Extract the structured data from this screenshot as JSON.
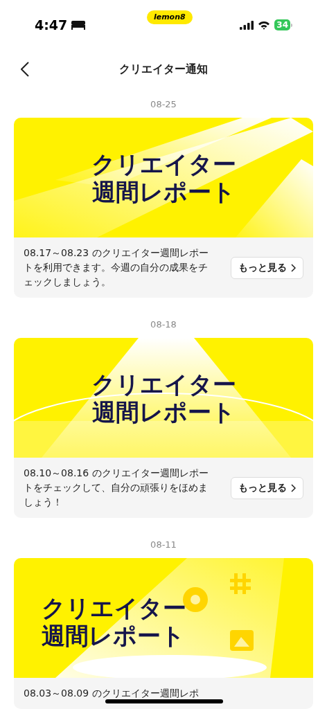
{
  "status_bar": {
    "time": "4:47",
    "app_badge": "lemon8",
    "battery": "34"
  },
  "header": {
    "title": "クリエイター通知"
  },
  "notifications": [
    {
      "date": "08-25",
      "banner": {
        "kind": "rays",
        "title_lines": [
          "クリエイター",
          "週間レポート"
        ]
      },
      "description": "08.17～08.23 のクリエイター週間レポートを利用できます。今週の自分の成果をチェックしましょう。",
      "button": "もっと見る"
    },
    {
      "date": "08-18",
      "banner": {
        "kind": "arc",
        "title_lines": [
          "クリエイター",
          "週間レポート"
        ]
      },
      "description": "08.10～08.16 のクリエイター週間レポートをチェックして、自分の頑張りをほめましょう！",
      "button": "もっと見る"
    },
    {
      "date": "08-11",
      "banner": {
        "kind": "stage",
        "title_lines": [
          "クリエイター",
          "週間レポート"
        ]
      },
      "description": "08.03～08.09 のクリエイター週間レポ"
    }
  ]
}
